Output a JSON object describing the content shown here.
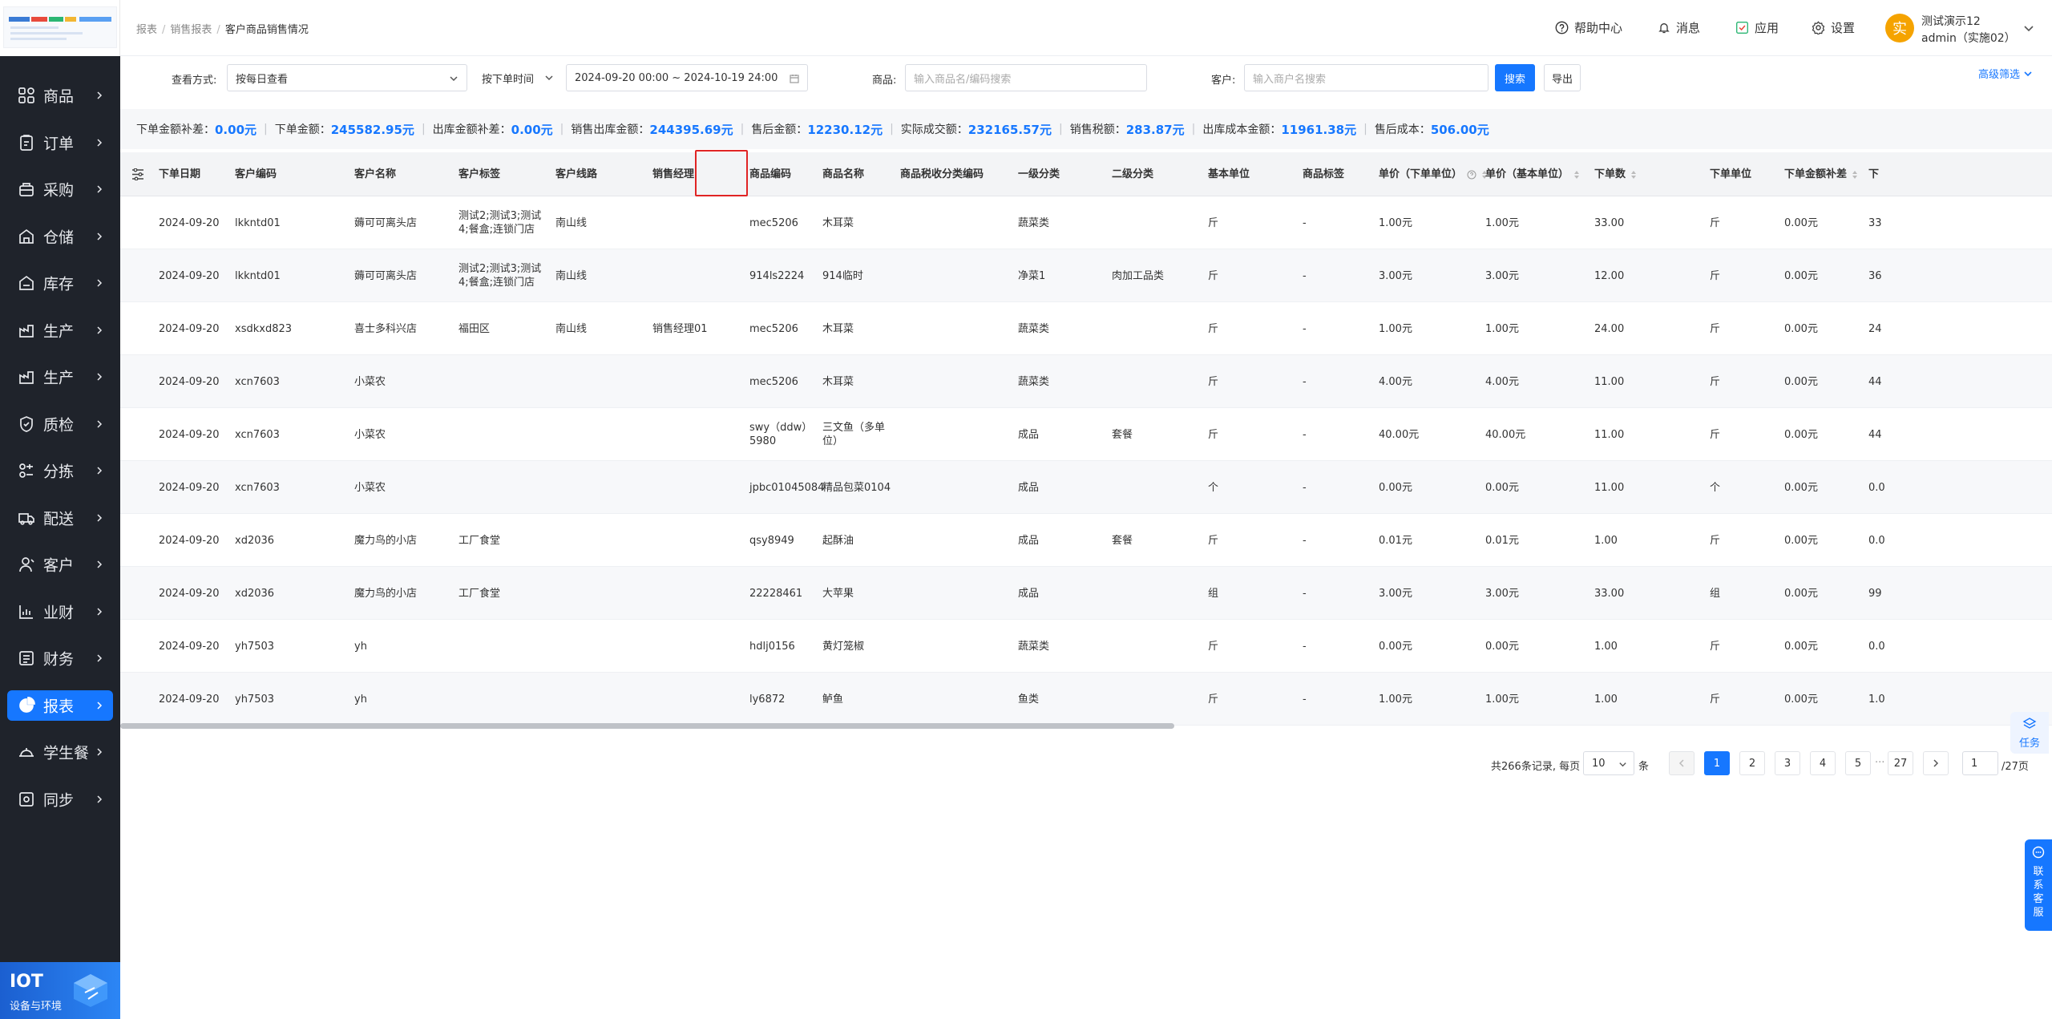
{
  "sidebar": {
    "items": [
      {
        "label": "商品",
        "icon": "grid-icon"
      },
      {
        "label": "订单",
        "icon": "order-icon"
      },
      {
        "label": "采购",
        "icon": "purchase-icon"
      },
      {
        "label": "仓储",
        "icon": "warehouse-icon"
      },
      {
        "label": "库存",
        "icon": "inventory-icon"
      },
      {
        "label": "生产",
        "icon": "production-icon"
      },
      {
        "label": "生产",
        "icon": "production-icon"
      },
      {
        "label": "质检",
        "icon": "shield-icon"
      },
      {
        "label": "分拣",
        "icon": "sort-icon"
      },
      {
        "label": "配送",
        "icon": "truck-icon"
      },
      {
        "label": "客户",
        "icon": "customer-icon"
      },
      {
        "label": "业财",
        "icon": "finance-chart-icon"
      },
      {
        "label": "财务",
        "icon": "finance-icon"
      },
      {
        "label": "报表",
        "icon": "pie-chart-icon",
        "active": true
      },
      {
        "label": "学生餐",
        "icon": "meal-icon"
      },
      {
        "label": "同步",
        "icon": "sync-icon"
      }
    ],
    "iot_title": "IOT",
    "iot_subtitle": "设备与环境"
  },
  "header": {
    "breadcrumb": [
      "报表",
      "销售报表",
      "客户商品销售情况"
    ],
    "help": "帮助中心",
    "messages": "消息",
    "apps": "应用",
    "settings": "设置",
    "avatar_char": "实",
    "user_name": "测试演示12",
    "user_role": "admin（实施02）"
  },
  "filters": {
    "view_mode_label": "查看方式:",
    "view_mode_value": "按每日查看",
    "time_type": "按下单时间",
    "date_range": "2024-09-20 00:00 ~ 2024-10-19 24:00",
    "product_label": "商品:",
    "product_placeholder": "输入商品名/编码搜索",
    "customer_label": "客户:",
    "customer_placeholder": "输入商户名搜索",
    "search_btn": "搜索",
    "export_btn": "导出",
    "advanced": "高级筛选"
  },
  "summary": [
    {
      "label": "下单金额补差：",
      "value": "0.00元"
    },
    {
      "label": "下单金额：",
      "value": "245582.95元"
    },
    {
      "label": "出库金额补差：",
      "value": "0.00元"
    },
    {
      "label": "销售出库金额：",
      "value": "244395.69元"
    },
    {
      "label": "售后金额：",
      "value": "12230.12元"
    },
    {
      "label": "实际成交额：",
      "value": "232165.57元"
    },
    {
      "label": "销售税额：",
      "value": "283.87元"
    },
    {
      "label": "出库成本金额：",
      "value": "11961.38元"
    },
    {
      "label": "售后成本：",
      "value": "506.00元"
    }
  ],
  "table": {
    "columns": [
      "下单日期",
      "客户编码",
      "客户名称",
      "客户标签",
      "客户线路",
      "销售经理",
      "商品编码",
      "商品名称",
      "商品税收分类编码",
      "一级分类",
      "二级分类",
      "基本单位",
      "商品标签",
      "单价（下单单位）",
      "单价（基本单位）",
      "下单数",
      "下单单位",
      "下单金额补差",
      "下"
    ],
    "rows": [
      [
        "2024-09-20",
        "lkkntd01",
        "薅可可离头店",
        "测试2;测试3;测试4;餐盒;连锁门店",
        "南山线",
        "",
        "mec5206",
        "木耳菜",
        "",
        "蔬菜类",
        "",
        "斤",
        "-",
        "1.00元",
        "1.00元",
        "33.00",
        "斤",
        "0.00元",
        "33"
      ],
      [
        "2024-09-20",
        "lkkntd01",
        "薅可可离头店",
        "测试2;测试3;测试4;餐盒;连锁门店",
        "南山线",
        "",
        "914ls2224",
        "914临时",
        "",
        "净菜1",
        "肉加工品类",
        "斤",
        "-",
        "3.00元",
        "3.00元",
        "12.00",
        "斤",
        "0.00元",
        "36"
      ],
      [
        "2024-09-20",
        "xsdkxd823",
        "喜士多科兴店",
        "福田区",
        "南山线",
        "销售经理01",
        "mec5206",
        "木耳菜",
        "",
        "蔬菜类",
        "",
        "斤",
        "-",
        "1.00元",
        "1.00元",
        "24.00",
        "斤",
        "0.00元",
        "24"
      ],
      [
        "2024-09-20",
        "xcn7603",
        "小菜农",
        "",
        "",
        "",
        "mec5206",
        "木耳菜",
        "",
        "蔬菜类",
        "",
        "斤",
        "-",
        "4.00元",
        "4.00元",
        "11.00",
        "斤",
        "0.00元",
        "44"
      ],
      [
        "2024-09-20",
        "xcn7603",
        "小菜农",
        "",
        "",
        "",
        "swy（ddw）5980",
        "三文鱼（多单位）",
        "",
        "成品",
        "套餐",
        "斤",
        "-",
        "40.00元",
        "40.00元",
        "11.00",
        "斤",
        "0.00元",
        "44"
      ],
      [
        "2024-09-20",
        "xcn7603",
        "小菜农",
        "",
        "",
        "",
        "jpbc01045084",
        "精品包菜0104",
        "",
        "成品",
        "",
        "个",
        "-",
        "0.00元",
        "0.00元",
        "11.00",
        "个",
        "0.00元",
        "0.0"
      ],
      [
        "2024-09-20",
        "xd2036",
        "魔力鸟的小店",
        "工厂食堂",
        "",
        "",
        "qsy8949",
        "起酥油",
        "",
        "成品",
        "套餐",
        "斤",
        "-",
        "0.01元",
        "0.01元",
        "1.00",
        "斤",
        "0.00元",
        "0.0"
      ],
      [
        "2024-09-20",
        "xd2036",
        "魔力鸟的小店",
        "工厂食堂",
        "",
        "",
        "22228461",
        "大苹果",
        "",
        "成品",
        "",
        "组",
        "-",
        "3.00元",
        "3.00元",
        "33.00",
        "组",
        "0.00元",
        "99"
      ],
      [
        "2024-09-20",
        "yh7503",
        "yh",
        "",
        "",
        "",
        "hdlj0156",
        "黄灯笼椒",
        "",
        "蔬菜类",
        "",
        "斤",
        "-",
        "0.00元",
        "0.00元",
        "1.00",
        "斤",
        "0.00元",
        "0.0"
      ],
      [
        "2024-09-20",
        "yh7503",
        "yh",
        "",
        "",
        "",
        "ly6872",
        "鲈鱼",
        "",
        "鱼类",
        "",
        "斤",
        "-",
        "1.00元",
        "1.00元",
        "1.00",
        "斤",
        "0.00元",
        "1.0"
      ]
    ]
  },
  "pagination": {
    "total": "共266条记录, 每页",
    "page_size": "10",
    "unit": "条",
    "pages": [
      "1",
      "2",
      "3",
      "4",
      "5"
    ],
    "ellipsis": "···",
    "last": "27",
    "jump_value": "1",
    "total_pages": "/27页"
  },
  "float": {
    "task": "任务",
    "contact": "联系客服"
  },
  "colors": {
    "primary": "#1677ff",
    "sidebar_bg": "#1f232b",
    "highlight": "#e02424",
    "avatar": "#f5a300"
  }
}
